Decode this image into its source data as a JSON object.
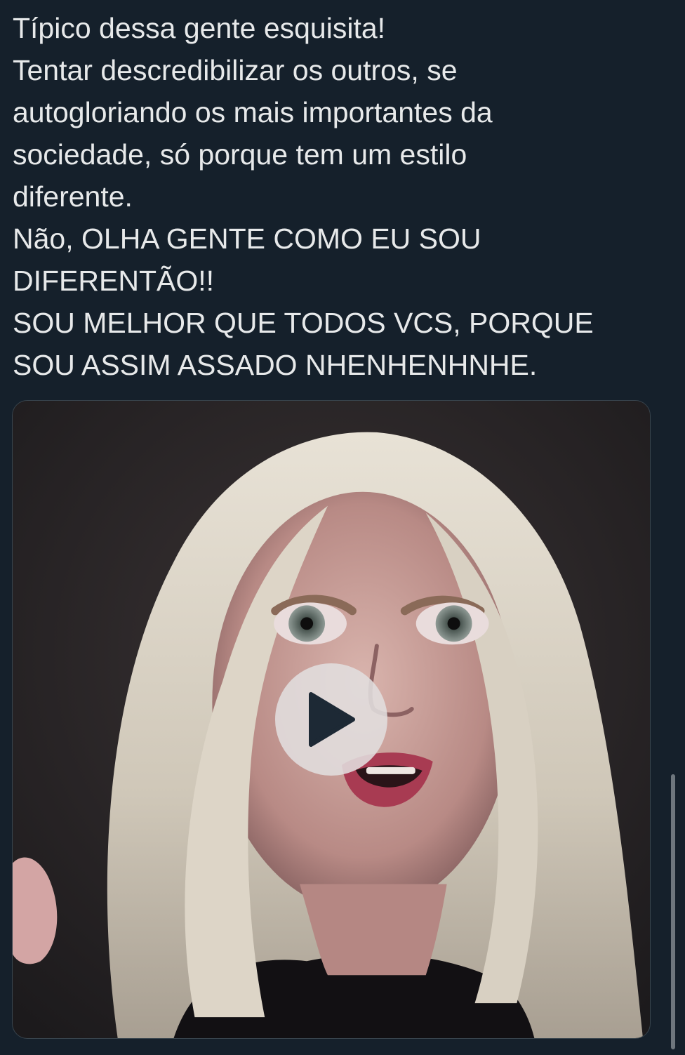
{
  "tweet": {
    "text_lines": [
      "Típico dessa gente esquisita!",
      "Tentar descredibilizar os outros, se",
      "autogloriando os mais importantes da",
      "sociedade, só porque tem um estilo",
      "diferente.",
      "Não, OLHA GENTE COMO EU SOU",
      "DIFERENTÃO!!",
      "SOU MELHOR QUE TODOS VCS, PORQUE",
      "SOU ASSIM ASSADO NHENHENHNHE."
    ]
  },
  "media": {
    "type": "gif",
    "play_icon": "play-icon"
  },
  "colors": {
    "background": "#15202b",
    "text": "#e7e9ea",
    "play_button_bg": "#e1dede",
    "play_triangle": "#1d2935"
  }
}
